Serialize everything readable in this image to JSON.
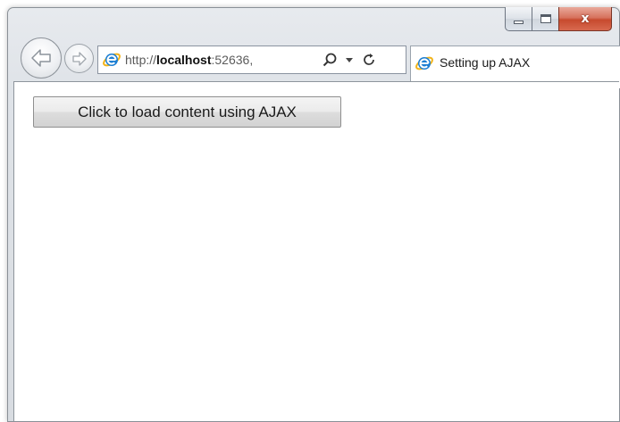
{
  "window": {
    "caption": {
      "close_glyph": "x"
    }
  },
  "navigation": {
    "back_icon": "back-arrow-icon",
    "forward_icon": "forward-arrow-icon"
  },
  "address_bar": {
    "url_scheme": "http://",
    "url_host": "localhost",
    "url_port": ":52636,",
    "site_icon": "ie-logo-icon",
    "search_icon": "search-icon",
    "dropdown_icon": "dropdown-arrow-icon",
    "refresh_icon": "refresh-icon"
  },
  "tab": {
    "title": "Setting up AJAX",
    "icon": "ie-logo-icon"
  },
  "page": {
    "load_button_label": "Click to load content using AJAX"
  },
  "colors": {
    "close_button": "#c74a2e",
    "ie_blue": "#1d7fd3",
    "ie_ring": "#f2b41c"
  }
}
